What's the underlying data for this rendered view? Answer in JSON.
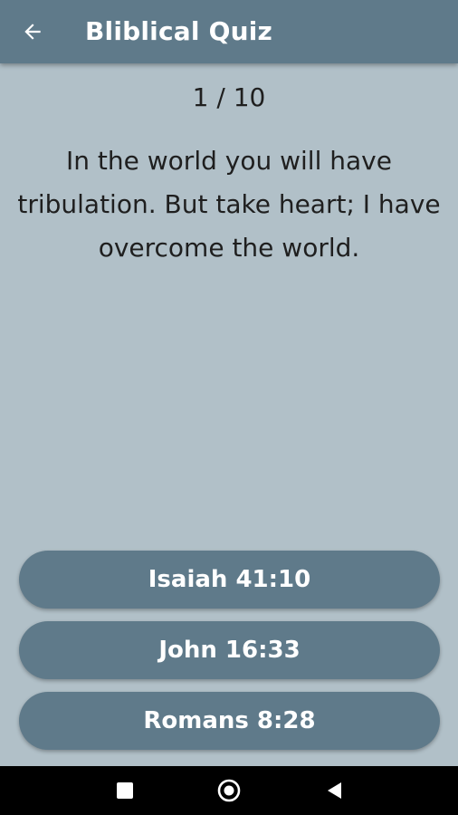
{
  "app_bar": {
    "title": "Bliblical Quiz",
    "back_icon": "arrow-left-icon",
    "background": "#5f7a8a"
  },
  "quiz": {
    "progress": "1 / 10",
    "question": "In the world you will have tribulation. But take heart; I have overcome the world.",
    "answers": [
      "Isaiah 41:10",
      "John 16:33",
      "Romans 8:28"
    ]
  },
  "nav_bar": {
    "icons": [
      "recents-square-icon",
      "home-circle-icon",
      "back-triangle-icon"
    ]
  },
  "colors": {
    "background": "#b1c0c8",
    "accent": "#5f7a8a",
    "text": "#1f1f1f"
  }
}
